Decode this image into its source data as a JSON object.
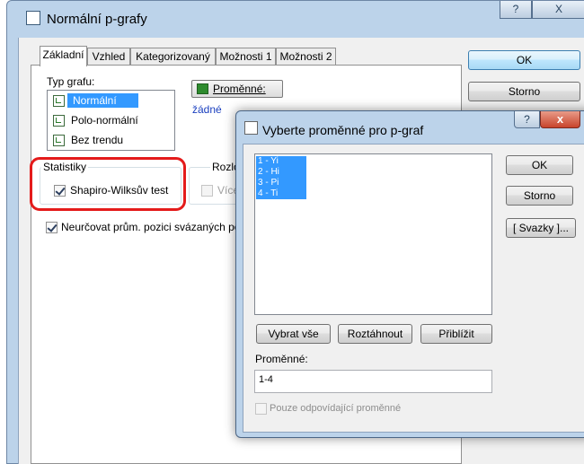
{
  "main_window": {
    "title": "Normální p-grafy",
    "help_button": "?",
    "close_button": "X",
    "tabs": [
      {
        "label": "Základní",
        "active": true
      },
      {
        "label": "Vzhled",
        "active": false
      },
      {
        "label": "Kategorizovaný",
        "active": false
      },
      {
        "label": "Možnosti 1",
        "active": false
      },
      {
        "label": "Možnosti 2",
        "active": false
      }
    ],
    "chart_type": {
      "label": "Typ grafu:",
      "items": [
        "Normální",
        "Polo-normální",
        "Bez trendu"
      ],
      "selected": "Normální"
    },
    "variables_button": "Proměnné:",
    "variables_value": "žádné",
    "statistics": {
      "title": "Statistiky",
      "shapiro_label": "Shapiro-Wilksův test",
      "shapiro_checked": true
    },
    "distribution": {
      "title": "Rozlože",
      "option_label": "Více",
      "checked": false,
      "enabled": false
    },
    "ties_checkbox": {
      "label": "Neurčovat prům. pozici svázaných po",
      "checked": true
    },
    "ok_button": "OK",
    "cancel_button": "Storno"
  },
  "dialog": {
    "title": "Vyberte proměnné pro p-graf",
    "help_button": "?",
    "close_button": "x",
    "variables": [
      "1 - Yi",
      "2 - Hi",
      "3 - Pi",
      "4 - Ti"
    ],
    "select_all_button": "Vybrat vše",
    "expand_button": "Roztáhnout",
    "zoom_button": "Přiblížit",
    "variables_label": "Proměnné:",
    "variables_value": "1-4",
    "only_matching_label": "Pouze odpovídající proměnné",
    "only_matching_checked": false,
    "ok_button": "OK",
    "cancel_button": "Storno",
    "bundles_button": "[ Svazky ]..."
  },
  "colors": {
    "selection": "#3399ff",
    "highlight": "#e41b1b",
    "frame": "#bcd3ea",
    "link": "#1a3fbf"
  }
}
